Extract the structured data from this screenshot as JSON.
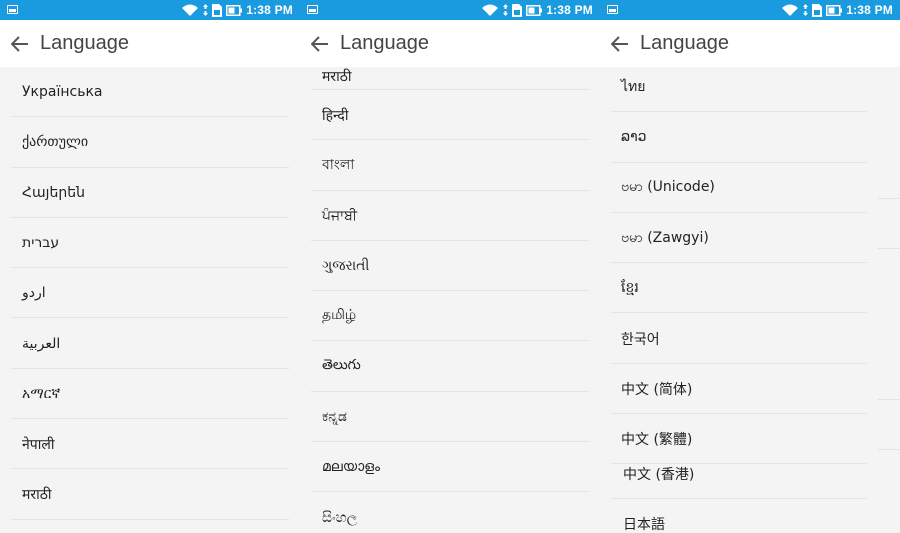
{
  "status": {
    "time": "1:38 PM"
  },
  "header": {
    "title": "Language"
  },
  "colors": {
    "statusbar": "#1a9be0",
    "list_bg": "#f4f4f4",
    "divider": "#e3e3e3",
    "title": "#444444"
  },
  "screens": [
    {
      "items": [
        "Українська",
        "ქართული",
        "Հայերեն",
        "עברית",
        "اردو",
        "العربية",
        "አማርኛ",
        "नेपाली",
        "मराठी"
      ]
    },
    {
      "partial_top": "मराठी",
      "items": [
        "हिन्दी",
        "বাংলা",
        "ਪੰਜਾਬੀ",
        "ગુજરાતી",
        "தமிழ்",
        "తెలుగు",
        "ಕನ್ನಡ",
        "മലയാളം",
        "සිංහල"
      ]
    },
    {
      "items": [
        "ไทย",
        "ລາວ",
        "ဗမာ (Unicode)",
        "ဗမာ (Zawgyi)",
        "ខ្មែរ",
        "한국어",
        "中文 (简体)",
        "中文 (繁體)"
      ],
      "dragged_item": "中文 (香港)",
      "bottom_item": "日本語"
    }
  ]
}
